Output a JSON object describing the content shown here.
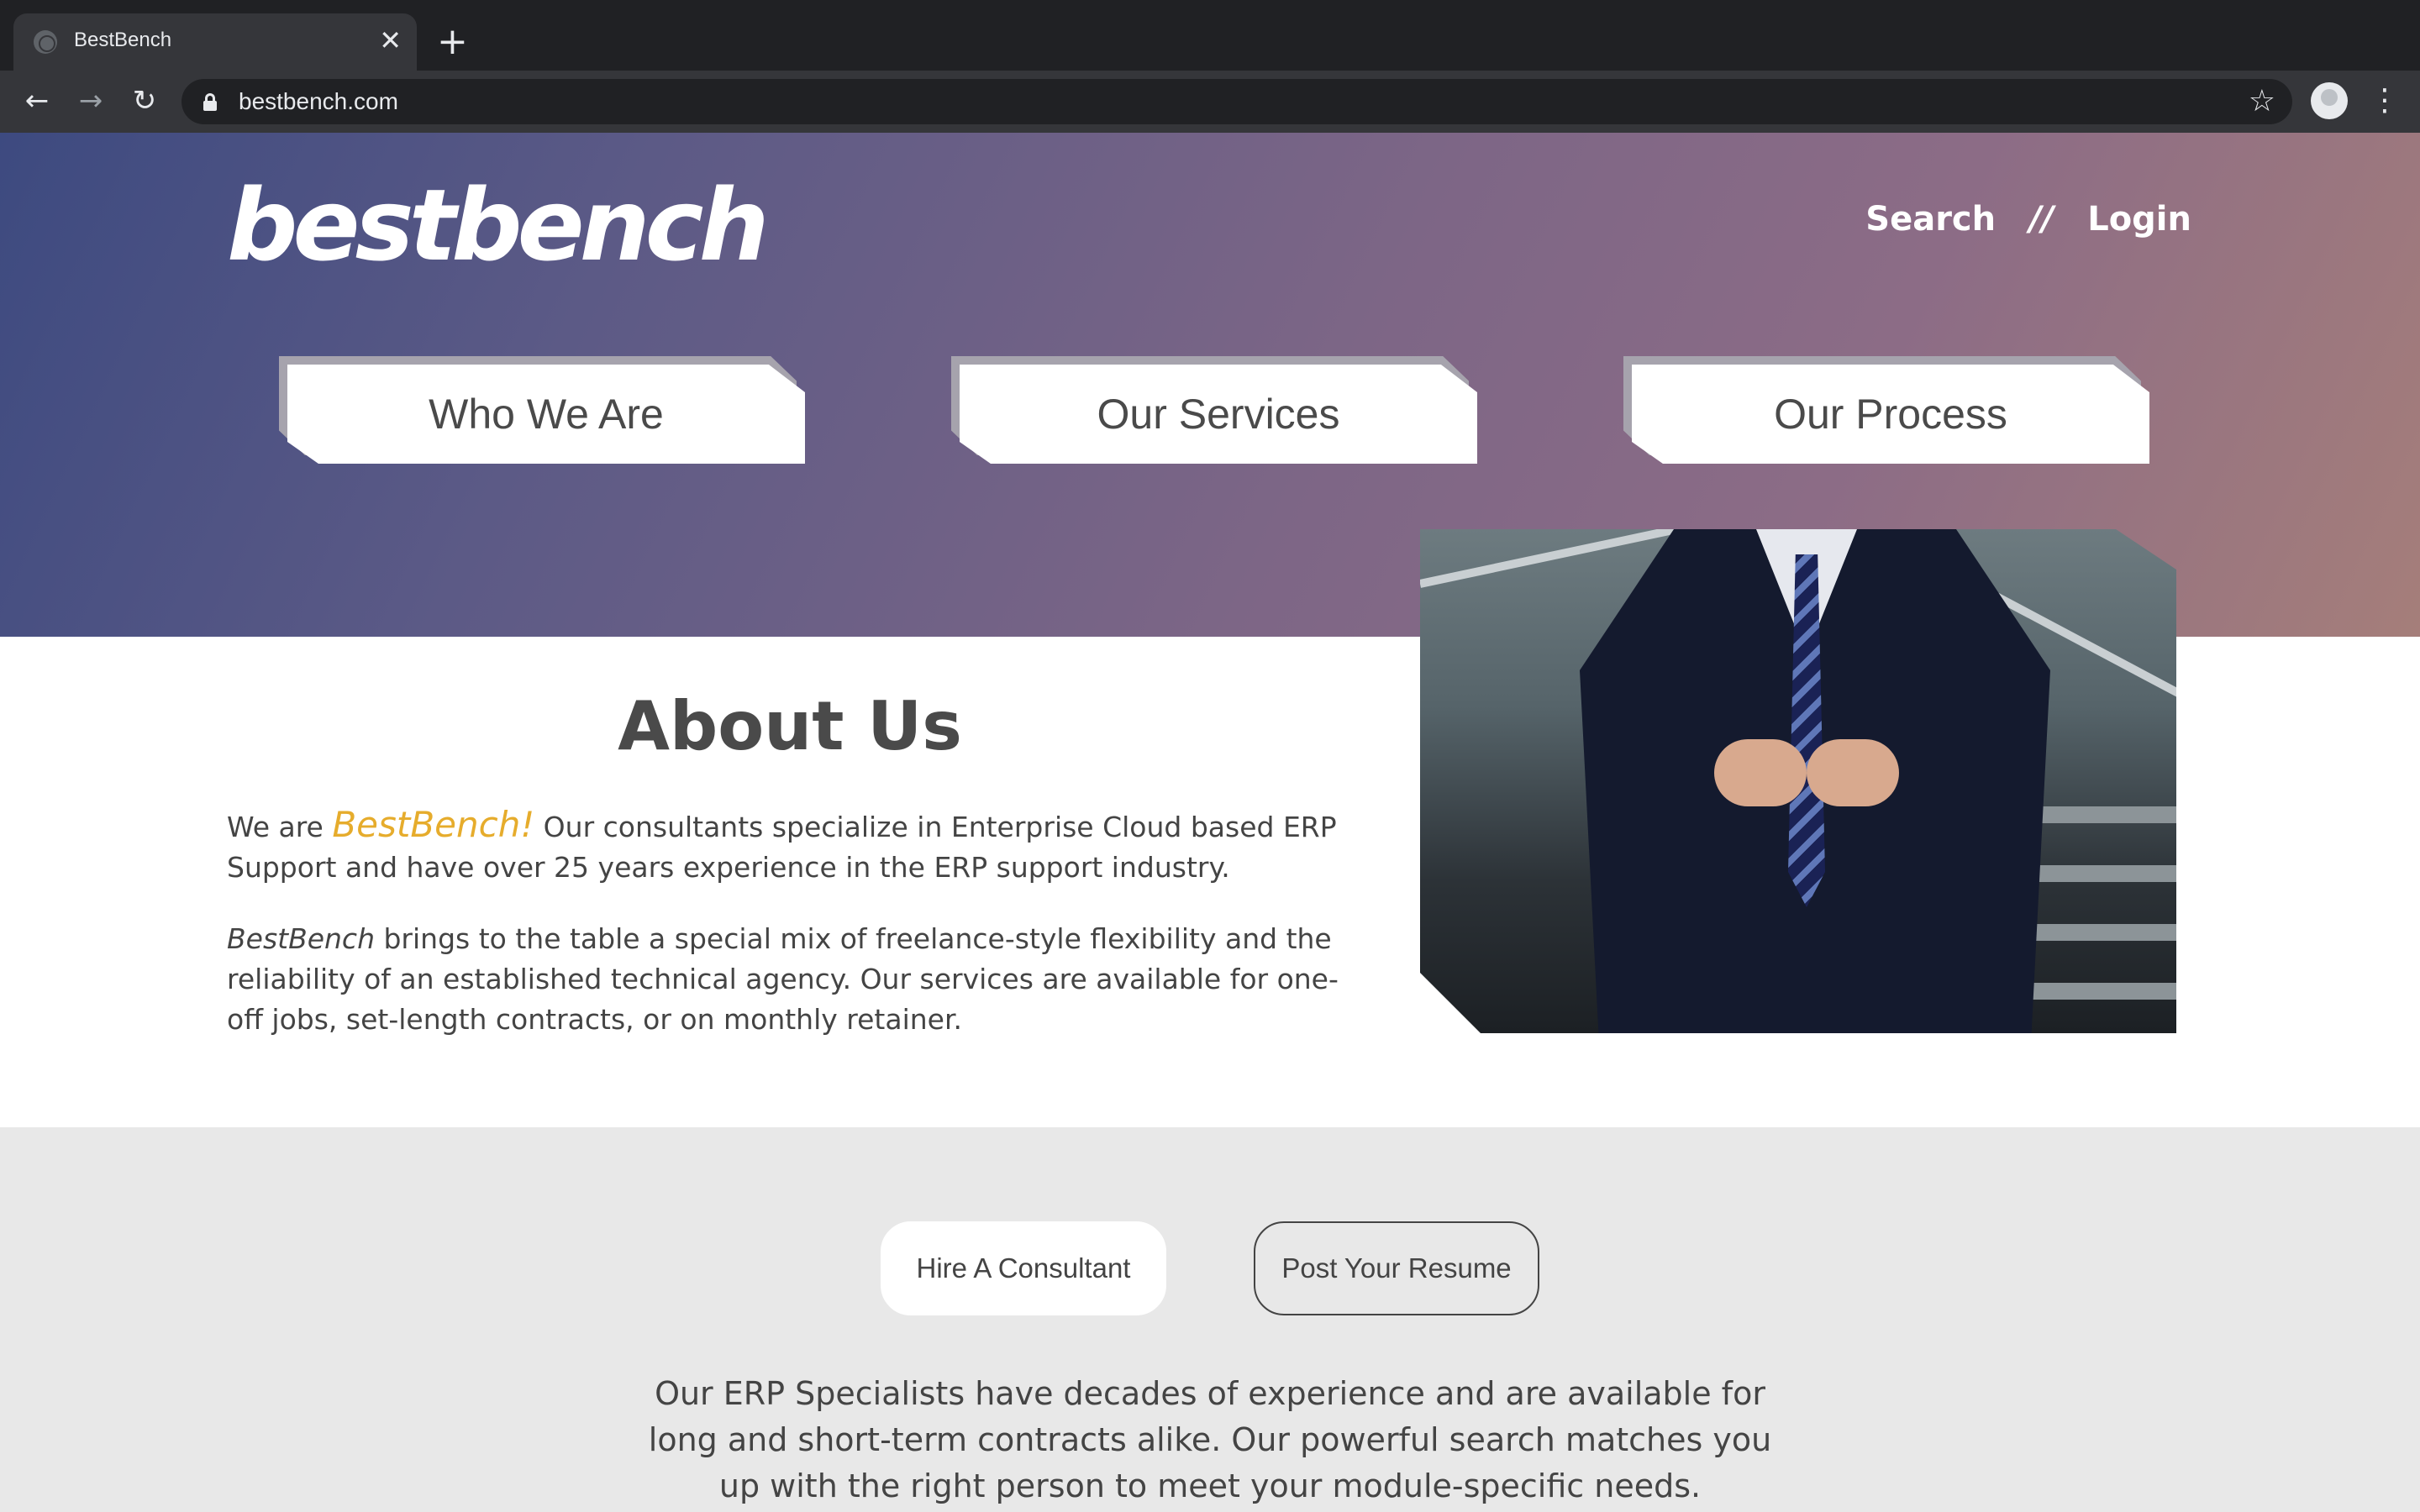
{
  "browser": {
    "tab_title": "BestBench",
    "tab_close": "✕",
    "new_tab": "+",
    "back": "←",
    "forward": "→",
    "reload": "↻",
    "url": "bestbench.com",
    "bookmark": "☆",
    "menu": "⋮"
  },
  "header": {
    "logo_text": "bestbench",
    "search_label": "Search",
    "separator": "//",
    "login_label": "Login"
  },
  "nav": {
    "items": [
      {
        "label": "Who We Are"
      },
      {
        "label": "Our Services"
      },
      {
        "label": "Our Process"
      }
    ]
  },
  "about": {
    "title": "About Us",
    "p1_prefix": "We are ",
    "p1_brand": "BestBench!",
    "p1_rest": " Our consultants specialize in Enterprise Cloud based ERP Support and have over 25 years experience in the ERP support industry.",
    "p2_brand": "BestBench",
    "p2_rest": " brings to the table a special mix of freelance-style flexibility and the reliability of an established technical agency. Our services are available for one-off jobs, set-length contracts, or on monthly retainer."
  },
  "cta": {
    "hire_label": "Hire A Consultant",
    "resume_label": "Post Your Resume",
    "description": "Our ERP Specialists have decades of experience and are available for long and short-term contracts alike. Our powerful search matches you up with the right person to meet your module-specific needs."
  },
  "colors": {
    "brand_accent": "#e6ac2c",
    "hero_gradient_start": "#3d4a80",
    "hero_gradient_end": "#a57e7a",
    "grey_section": "#e8e8e8"
  },
  "icons": {
    "tab_favicon": "globe-icon",
    "lock": "lock-icon",
    "bookmark": "star-icon",
    "profile": "avatar-icon",
    "menu": "kebab-menu-icon"
  }
}
